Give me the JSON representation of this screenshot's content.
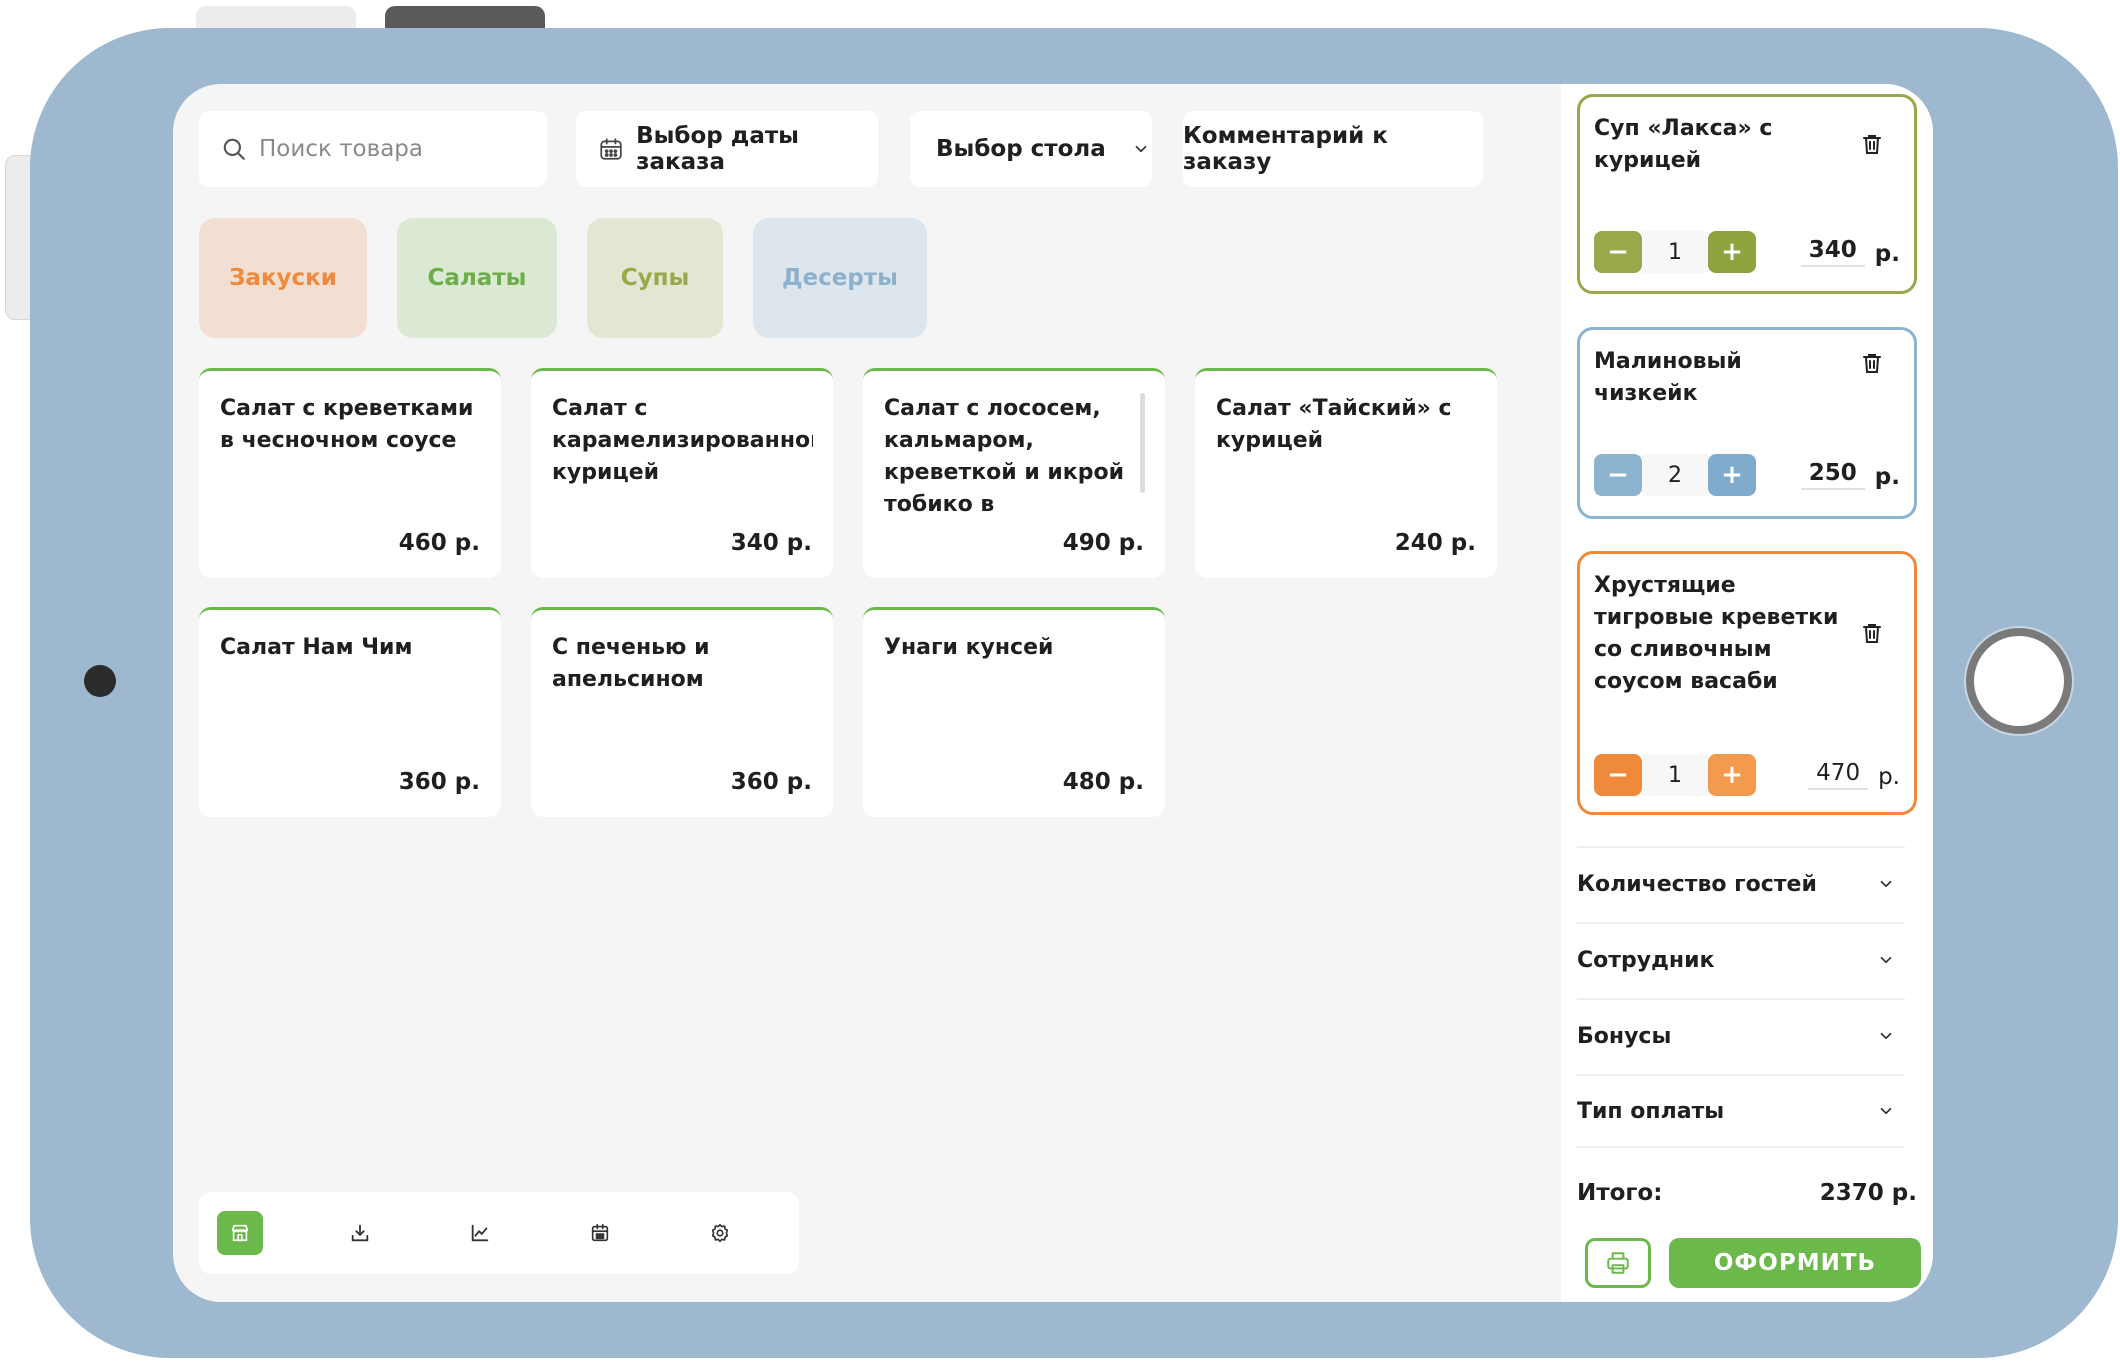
{
  "topbar": {
    "search_placeholder": "Поиск товара",
    "date_label": "Выбор даты заказа",
    "table_label": "Выбор стола",
    "comment_label": "Комментарий к заказу"
  },
  "categories": [
    {
      "label": "Закуски",
      "color": "#ef8a3c"
    },
    {
      "label": "Салаты",
      "color": "#6cae4a"
    },
    {
      "label": "Супы",
      "color": "#9aa84b"
    },
    {
      "label": "Десерты",
      "color": "#8cb1cc"
    }
  ],
  "products": [
    {
      "name": "Салат с креветками в чесночном соусе",
      "price": "460 р."
    },
    {
      "name": "Салат с карамелизированной курицей",
      "price": "340 р."
    },
    {
      "name": "Салат с лососем, кальмаром, креветкой и икрой тобико в сливочном",
      "price": "490 р."
    },
    {
      "name": "Салат «Тайский» с курицей",
      "price": "240 р."
    },
    {
      "name": "Салат Нам Чим",
      "price": "360 р."
    },
    {
      "name": "С печенью и апельсином",
      "price": "360 р."
    },
    {
      "name": "Унаги кунсей",
      "price": "480 р."
    }
  ],
  "bottom_nav": [
    {
      "icon": "store-icon",
      "active": true
    },
    {
      "icon": "download-icon",
      "active": false
    },
    {
      "icon": "chart-icon",
      "active": false
    },
    {
      "icon": "calendar-icon",
      "active": false
    },
    {
      "icon": "settings-icon",
      "active": false
    }
  ],
  "order": {
    "items": [
      {
        "name": "Суп «Лакса» с курицей",
        "qty": "1",
        "price": "340",
        "currency": "р.",
        "color": "#9aa84b"
      },
      {
        "name": "Малиновый чизкейк",
        "qty": "2",
        "price": "250",
        "currency": "р.",
        "color": "#8db4cf"
      },
      {
        "name": "Хрустящие тигровые креветки со сливочным соусом васаби",
        "qty": "1",
        "price": "470",
        "currency": "р.",
        "color": "#ef8a3c"
      }
    ],
    "minus_symbol": "−",
    "plus_symbol": "+",
    "dropdowns": [
      "Количество гостей",
      "Сотрудник",
      "Бонусы",
      "Тип оплаты"
    ],
    "total_label": "Итого:",
    "total_value": "2370 р.",
    "submit_label": "ОФОРМИТЬ"
  },
  "accent_color": "#6cb94b"
}
